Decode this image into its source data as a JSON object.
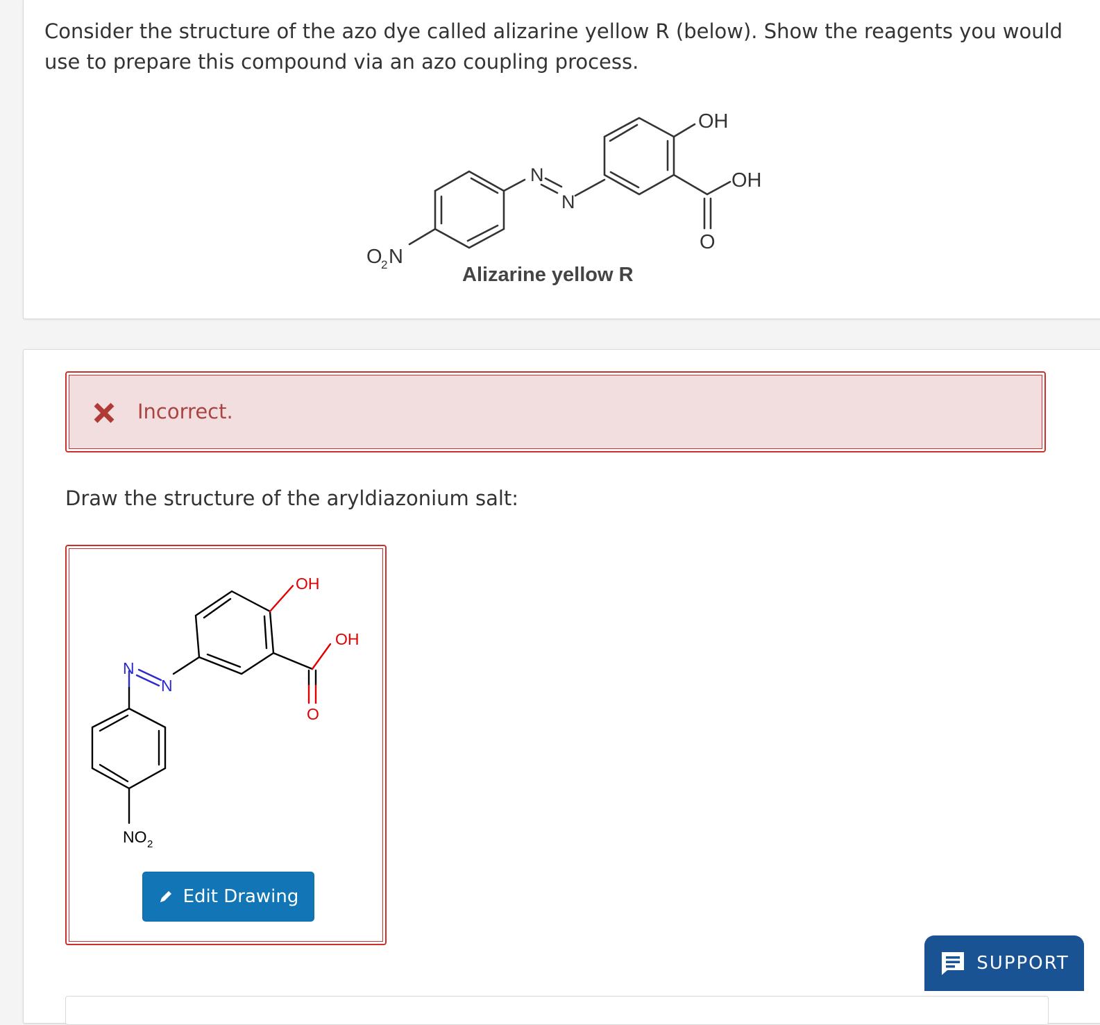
{
  "question": {
    "text": "Consider the structure of the azo dye called alizarine yellow R (below). Show the reagents you would use to prepare this compound via an azo coupling process.",
    "figure": {
      "caption": "Alizarine yellow R",
      "labels": {
        "nitro_o": "O",
        "nitro_sub": "2",
        "nitro_n": "N",
        "azo_n1": "N",
        "azo_n2": "N",
        "oh_top": "OH",
        "oh_acid": "OH",
        "o_carbonyl": "O"
      }
    }
  },
  "feedback": {
    "status": "Incorrect.",
    "icon": "x-icon",
    "color": "#a94442"
  },
  "prompt": "Draw the structure of the aryldiazonium salt:",
  "drawing": {
    "labels": {
      "oh_top": "OH",
      "oh_acid": "OH",
      "o_carbonyl": "O",
      "azo_n1": "N",
      "azo_n2": "N",
      "no2": "NO",
      "no2_sub": "2"
    },
    "edit_button": "Edit Drawing",
    "edit_icon": "pencil-icon"
  },
  "support": {
    "label": "SUPPORT",
    "icon": "chat-icon",
    "color": "#1a5394"
  }
}
